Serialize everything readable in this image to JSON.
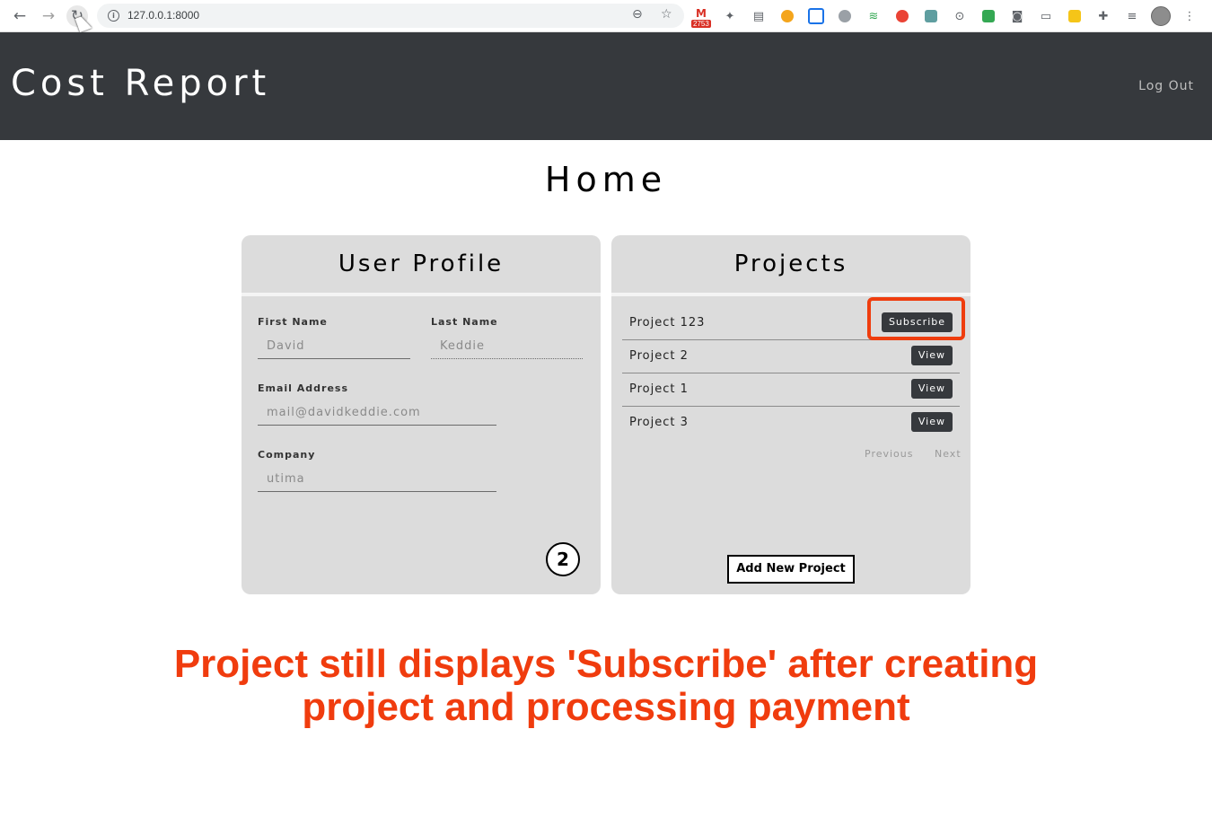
{
  "browser": {
    "url": "127.0.0.1:8000",
    "gmail_badge": "2753",
    "icons": [
      "back-icon",
      "forward-icon",
      "reload-icon",
      "info-icon",
      "zoom-icon",
      "star-icon"
    ]
  },
  "header": {
    "brand": "Cost Report",
    "logout_label": "Log Out"
  },
  "page": {
    "title": "Home"
  },
  "profile": {
    "heading": "User Profile",
    "first_name_label": "First Name",
    "first_name_value": "David",
    "last_name_label": "Last Name",
    "last_name_value": "Keddie",
    "email_label": "Email Address",
    "email_value": "mail@davidkeddie.com",
    "company_label": "Company",
    "company_value": "utima",
    "chat_badge": "2"
  },
  "projects": {
    "heading": "Projects",
    "items": [
      {
        "name": "Project 123",
        "action": "Subscribe"
      },
      {
        "name": "Project 2",
        "action": "View"
      },
      {
        "name": "Project 1",
        "action": "View"
      },
      {
        "name": "Project 3",
        "action": "View"
      }
    ],
    "previous_label": "Previous",
    "next_label": "Next",
    "add_label": "Add New Project"
  },
  "annotation": {
    "line1": "Project still displays 'Subscribe' after creating",
    "line2": "project and processing payment",
    "color": "#f03c0e"
  }
}
